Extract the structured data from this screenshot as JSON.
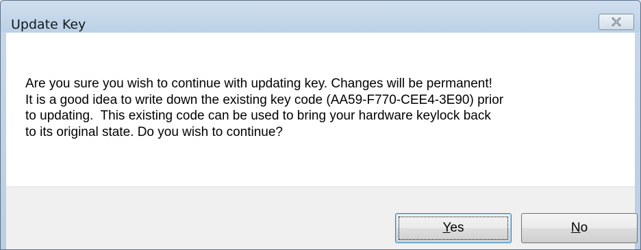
{
  "window": {
    "title": "Update Key"
  },
  "icons": {
    "close": "close-icon"
  },
  "message": {
    "lines": [
      "Are you sure you wish to continue with updating key. Changes will be permanent!",
      "It is a good idea to write down the existing key code (AA59-F770-CEE4-3E90) prior",
      "to updating.  This existing code can be used to bring your hardware keylock back",
      "to its original state. Do you wish to continue?"
    ]
  },
  "buttons": {
    "yes": {
      "mnemonic": "Y",
      "rest": "es"
    },
    "no": {
      "mnemonic": "N",
      "rest": "o"
    }
  },
  "colors": {
    "titlebar": "#c9d9ea",
    "client": "#ffffff",
    "button_area": "#f0f0f0",
    "default_button_border": "#3c7fb1"
  }
}
